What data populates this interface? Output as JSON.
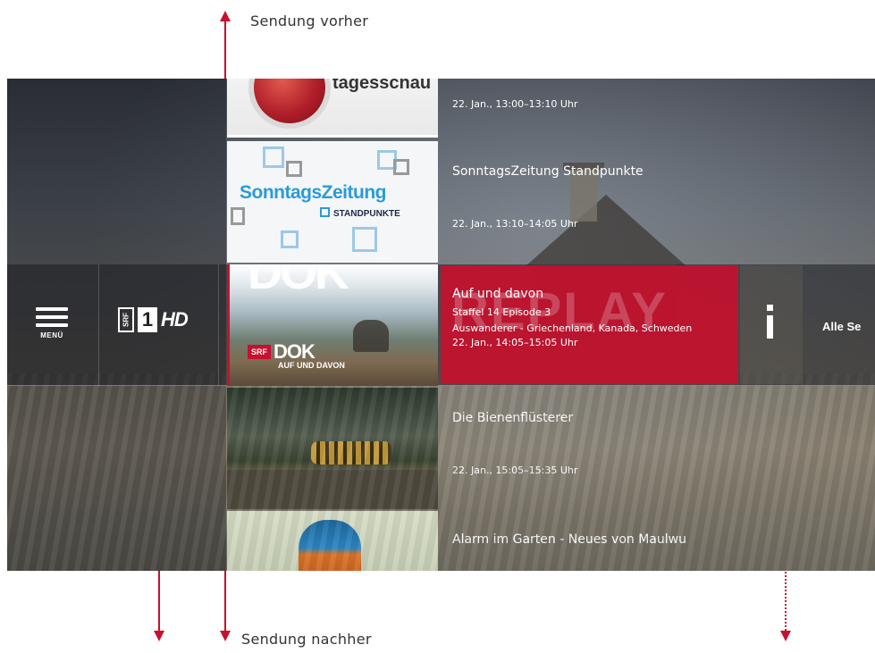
{
  "annotations": {
    "previous_show": "Sendung vorher",
    "next_show": "Sendung nachher"
  },
  "menu": {
    "label": "MENÜ",
    "icon": "hamburger-icon"
  },
  "channel": {
    "srf": "SRF",
    "number": "1",
    "hd": "HD"
  },
  "programs": [
    {
      "logo_text": "tagesschau",
      "title": "",
      "time": "22. Jan., 13:00–13:10 Uhr"
    },
    {
      "logo_text": "SonntagsZeitung",
      "logo_sub": "STANDPUNKTE",
      "title": "SonntagsZeitung Standpunkte",
      "time": "22. Jan., 13:10–14:05 Uhr"
    },
    {
      "logo_text": "DOK",
      "badge": "SRF",
      "badge_title": "DOK",
      "badge_sub": "AUF UND DAVON",
      "title": "Auf und davon",
      "episode": "Staffel 14 Episode 3",
      "description": "Auswanderer - Griechenland, Kanada, Schweden",
      "time": "22. Jan., 14:05–15:05 Uhr",
      "watermark": "REPLAY"
    },
    {
      "title": "Die Bienenflüsterer",
      "time": "22. Jan., 15:05–15:35 Uhr"
    },
    {
      "title": "Alarm im Garten - Neues von Maulwu"
    }
  ],
  "info_button": {
    "icon": "info-icon"
  },
  "all_shows": "Alle Se",
  "colors": {
    "accent": "#c8102e",
    "selected_bg": "#c8102e"
  }
}
